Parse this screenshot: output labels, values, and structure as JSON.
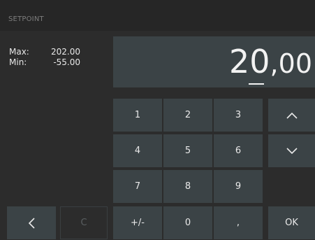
{
  "header": {
    "title": "SETPOINT"
  },
  "limits": {
    "max_label": "Max:",
    "max_value": "202.00",
    "min_label": "Min:",
    "min_value": "-55.00"
  },
  "display": {
    "integer_part": "20",
    "decimal_separator": ",",
    "decimal_part": "00"
  },
  "keypad": {
    "k1": "1",
    "k2": "2",
    "k3": "3",
    "k4": "4",
    "k5": "5",
    "k6": "6",
    "k7": "7",
    "k8": "8",
    "k9": "9",
    "plusminus": "+/-",
    "k0": "0",
    "comma": ",",
    "ok": "OK",
    "clear": "C"
  },
  "icons": {
    "up": "chevron-up-icon",
    "down": "chevron-down-icon",
    "back": "chevron-left-icon"
  },
  "colors": {
    "background": "#2c2c2c",
    "header": "#262626",
    "key": "#3b4346",
    "text": "#e9e9e9"
  }
}
